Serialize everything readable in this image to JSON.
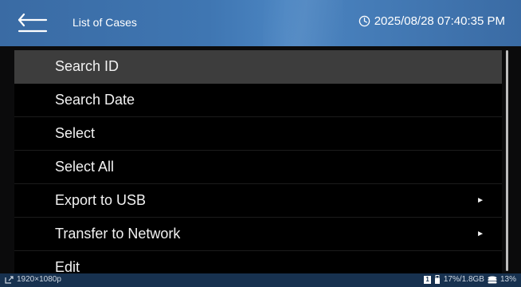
{
  "header": {
    "title": "List of Cases",
    "datetime": "2025/08/28 07:40:35 PM"
  },
  "menu": {
    "items": [
      {
        "label": "Search ID",
        "selected": true,
        "submenu": false
      },
      {
        "label": "Search Date",
        "selected": false,
        "submenu": false
      },
      {
        "label": "Select",
        "selected": false,
        "submenu": false
      },
      {
        "label": "Select All",
        "selected": false,
        "submenu": false
      },
      {
        "label": "Export to USB",
        "selected": false,
        "submenu": true
      },
      {
        "label": "Transfer to Network",
        "selected": false,
        "submenu": true
      },
      {
        "label": "Edit",
        "selected": false,
        "submenu": false
      }
    ]
  },
  "status": {
    "resolution": "1920×1080p",
    "usb_slot": "1",
    "storage": "17%/1.8GB",
    "disk": "13%"
  },
  "colors": {
    "header": "#3f76b2",
    "status_bar": "#17314f",
    "selected_row": "#3d3d3d"
  }
}
